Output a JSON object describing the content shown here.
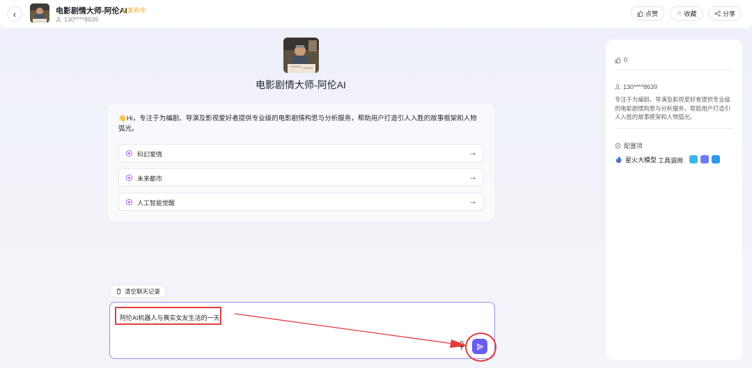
{
  "header": {
    "title": "电影剧情大师-阿伦AI",
    "status": "发布中",
    "owner": "130****8639",
    "like_label": "点赞",
    "favorite_label": "收藏",
    "share_label": "分享"
  },
  "bot": {
    "name": "电影剧情大师-阿伦AI",
    "greeting": "👋Hi，专注于为编剧、导演及影视爱好者提供专业级的电影剧情构思与分析服务，帮助用户打造引人入胜的故事框架和人物弧光。",
    "suggestions": [
      "科幻爱情",
      "未来都市",
      "人工智能觉醒"
    ]
  },
  "chat": {
    "clear_label": "清空聊天记录",
    "input_value": "阿伦AI机器人与真实女友生活的一天"
  },
  "panel": {
    "likes": "0",
    "owner": "130****8639",
    "description": "专注于为编剧、导演及影视爱好者提供专业级的电影剧情构思与分析服务，帮助用户打造引人入胜的故事框架和人物弧光。",
    "config_label": "配置项",
    "model_label": "星火大模型",
    "tools_label": "工具调用"
  },
  "colors": {
    "accent": "#6a5cf0",
    "highlight": "#e33b3b",
    "status": "#f5a623",
    "suggestion_dot": "#a25ae8"
  },
  "icons": {
    "back": "chevron-left-icon",
    "like": "thumbs-up-icon",
    "favorite": "star-icon",
    "share": "share-icon",
    "user": "user-icon",
    "clear": "trash-icon",
    "mic": "microphone-icon",
    "send": "send-icon",
    "config": "settings-icon"
  }
}
